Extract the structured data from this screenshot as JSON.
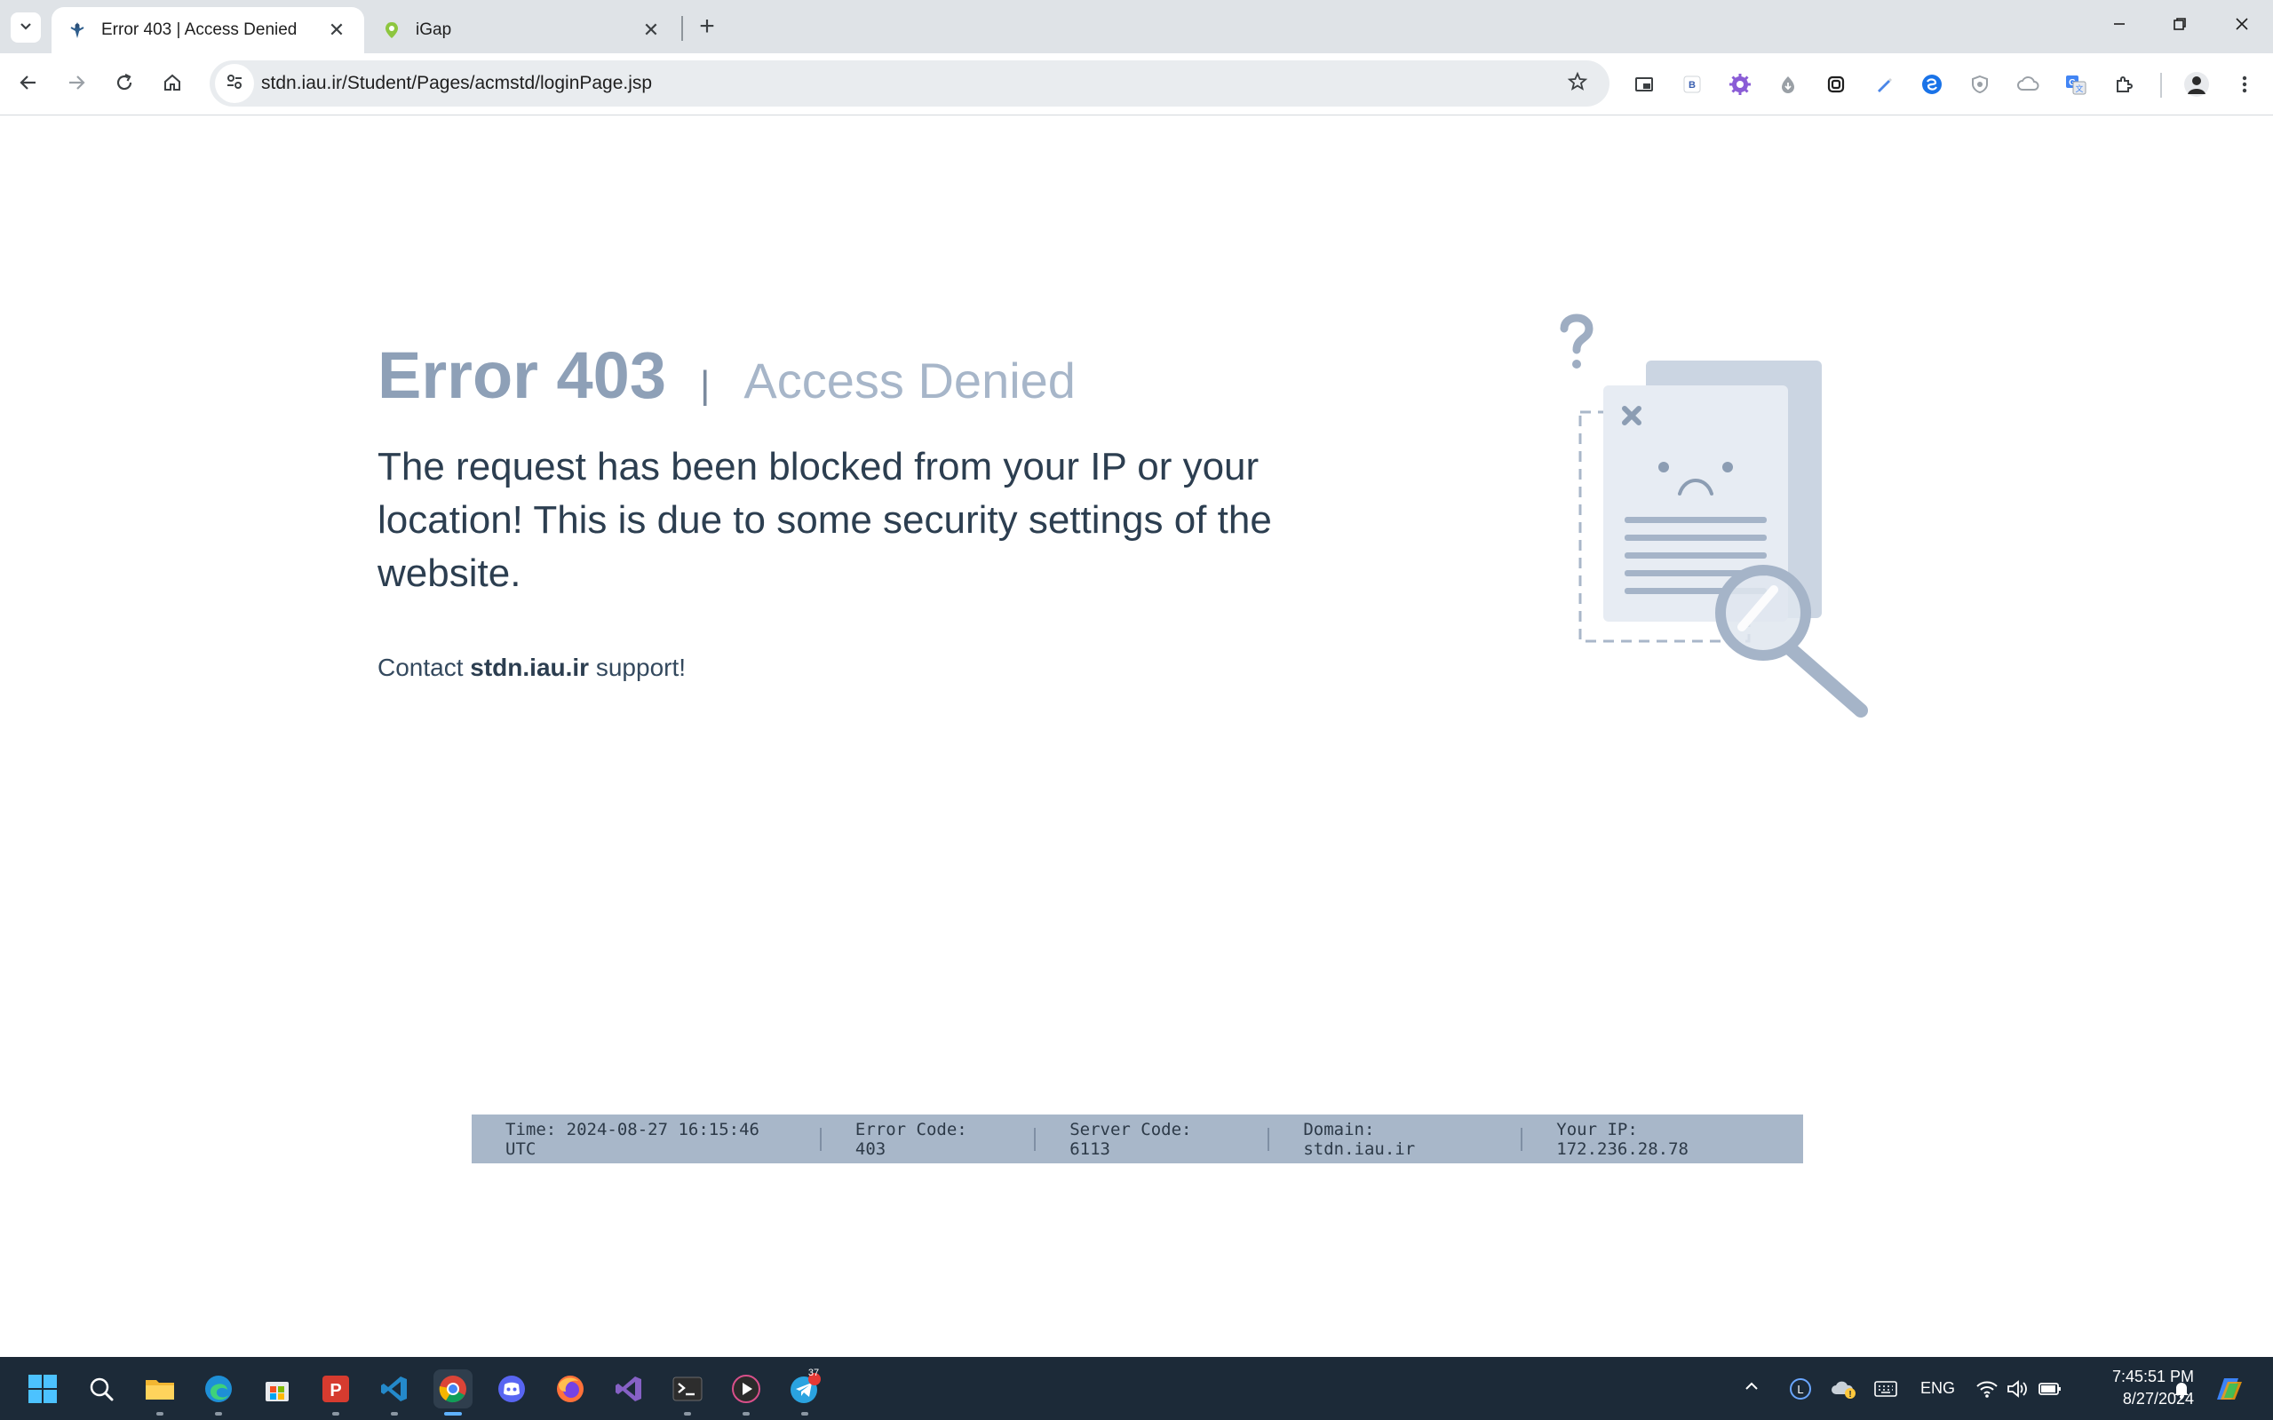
{
  "browser": {
    "tabs": [
      {
        "title": "Error 403  | Access Denied",
        "active": true
      },
      {
        "title": "iGap",
        "active": false
      }
    ],
    "url": "stdn.iau.ir/Student/Pages/acmstd/loginPage.jsp",
    "extensions": [
      "picture-in-picture-icon",
      "b-extension-icon",
      "gear-extension-icon",
      "download-extension-icon",
      "link-extension-icon",
      "pen-extension-icon",
      "swirl-extension-icon",
      "shield-extension-icon",
      "cloud-extension-icon",
      "translate-extension-icon",
      "puzzle-icon"
    ]
  },
  "page": {
    "error_code": "Error 403",
    "separator": "|",
    "error_subtitle": "Access Denied",
    "message": "The request has been blocked from your IP or your location! This is due to some security settings of the website.",
    "contact_prefix": "Contact",
    "contact_domain": "stdn.iau.ir",
    "contact_suffix": "support!",
    "footer": {
      "time": "Time: 2024-08-27 16:15:46 UTC",
      "error_code": "Error Code: 403",
      "server_code": "Server Code: 6113",
      "domain": "Domain: stdn.iau.ir",
      "ip": "Your IP: 172.236.28.78"
    }
  },
  "taskbar": {
    "language": "ENG",
    "time": "7:45:51 PM",
    "date": "8/27/2024",
    "telegram_badge": "37"
  },
  "colors": {
    "error_code": "#8ea0b7",
    "subtitle": "#a7b6c9",
    "footer_bg": "#a8b7c9",
    "taskbar_bg": "#1c2a38"
  }
}
